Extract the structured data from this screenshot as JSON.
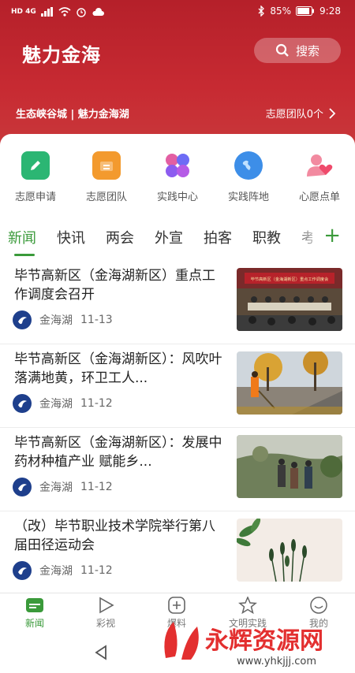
{
  "status_bar": {
    "left_icons": "HD 4G",
    "battery": "85%",
    "time": "9:28"
  },
  "header": {
    "title": "魅力金海",
    "search_label": "搜索",
    "slogan": "生态峡谷城 | 魅力金海湖",
    "team_link": "志愿团队0个"
  },
  "quick_links": [
    {
      "label": "志愿申请",
      "icon": "pencil-icon",
      "color": "#2bb673"
    },
    {
      "label": "志愿团队",
      "icon": "briefcase-icon",
      "color": "#f39a2e"
    },
    {
      "label": "实践中心",
      "icon": "grid-icon",
      "color": "#7b5cff"
    },
    {
      "label": "实践阵地",
      "icon": "globe-icon",
      "color": "#3d8ee8"
    },
    {
      "label": "心愿点单",
      "icon": "user-heart-icon",
      "color": "#ef4a6b"
    }
  ],
  "tabs": [
    "新闻",
    "快讯",
    "两会",
    "外宣",
    "拍客",
    "职教",
    "考"
  ],
  "news": [
    {
      "title": "毕节高新区（金海湖新区）重点工作调度会召开",
      "source": "金海湖",
      "date": "11-13"
    },
    {
      "title": "毕节高新区（金海湖新区）：风吹叶落满地黄，环卫工人...",
      "source": "金海湖",
      "date": "11-12"
    },
    {
      "title": "毕节高新区（金海湖新区）：发展中药材种植产业 赋能乡...",
      "source": "金海湖",
      "date": "11-12"
    },
    {
      "title": "（改）毕节职业技术学院举行第八届田径运动会",
      "source": "金海湖",
      "date": "11-12"
    }
  ],
  "thumb_caption": "毕节高新区（金海湖新区）重点工作调度会",
  "bottom_nav": [
    "新闻",
    "彩视",
    "爆料",
    "文明实践",
    "我的"
  ],
  "watermark": {
    "brand": "永辉资源网",
    "url": "www.yhkjjj.com"
  },
  "colors": {
    "brand_red": "#c72a32",
    "accent_green": "#3a9a3a"
  }
}
